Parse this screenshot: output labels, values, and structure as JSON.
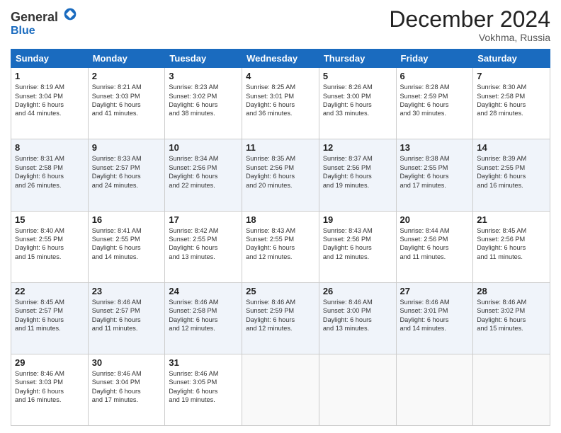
{
  "logo": {
    "general": "General",
    "blue": "Blue"
  },
  "header": {
    "month": "December 2024",
    "location": "Vokhma, Russia"
  },
  "days_of_week": [
    "Sunday",
    "Monday",
    "Tuesday",
    "Wednesday",
    "Thursday",
    "Friday",
    "Saturday"
  ],
  "weeks": [
    [
      {
        "day": "1",
        "sunrise": "8:19 AM",
        "sunset": "3:04 PM",
        "daylight": "6 hours and 44 minutes."
      },
      {
        "day": "2",
        "sunrise": "8:21 AM",
        "sunset": "3:03 PM",
        "daylight": "6 hours and 41 minutes."
      },
      {
        "day": "3",
        "sunrise": "8:23 AM",
        "sunset": "3:02 PM",
        "daylight": "6 hours and 38 minutes."
      },
      {
        "day": "4",
        "sunrise": "8:25 AM",
        "sunset": "3:01 PM",
        "daylight": "6 hours and 36 minutes."
      },
      {
        "day": "5",
        "sunrise": "8:26 AM",
        "sunset": "3:00 PM",
        "daylight": "6 hours and 33 minutes."
      },
      {
        "day": "6",
        "sunrise": "8:28 AM",
        "sunset": "2:59 PM",
        "daylight": "6 hours and 30 minutes."
      },
      {
        "day": "7",
        "sunrise": "8:30 AM",
        "sunset": "2:58 PM",
        "daylight": "6 hours and 28 minutes."
      }
    ],
    [
      {
        "day": "8",
        "sunrise": "8:31 AM",
        "sunset": "2:58 PM",
        "daylight": "6 hours and 26 minutes."
      },
      {
        "day": "9",
        "sunrise": "8:33 AM",
        "sunset": "2:57 PM",
        "daylight": "6 hours and 24 minutes."
      },
      {
        "day": "10",
        "sunrise": "8:34 AM",
        "sunset": "2:56 PM",
        "daylight": "6 hours and 22 minutes."
      },
      {
        "day": "11",
        "sunrise": "8:35 AM",
        "sunset": "2:56 PM",
        "daylight": "6 hours and 20 minutes."
      },
      {
        "day": "12",
        "sunrise": "8:37 AM",
        "sunset": "2:56 PM",
        "daylight": "6 hours and 19 minutes."
      },
      {
        "day": "13",
        "sunrise": "8:38 AM",
        "sunset": "2:55 PM",
        "daylight": "6 hours and 17 minutes."
      },
      {
        "day": "14",
        "sunrise": "8:39 AM",
        "sunset": "2:55 PM",
        "daylight": "6 hours and 16 minutes."
      }
    ],
    [
      {
        "day": "15",
        "sunrise": "8:40 AM",
        "sunset": "2:55 PM",
        "daylight": "6 hours and 15 minutes."
      },
      {
        "day": "16",
        "sunrise": "8:41 AM",
        "sunset": "2:55 PM",
        "daylight": "6 hours and 14 minutes."
      },
      {
        "day": "17",
        "sunrise": "8:42 AM",
        "sunset": "2:55 PM",
        "daylight": "6 hours and 13 minutes."
      },
      {
        "day": "18",
        "sunrise": "8:43 AM",
        "sunset": "2:55 PM",
        "daylight": "6 hours and 12 minutes."
      },
      {
        "day": "19",
        "sunrise": "8:43 AM",
        "sunset": "2:56 PM",
        "daylight": "6 hours and 12 minutes."
      },
      {
        "day": "20",
        "sunrise": "8:44 AM",
        "sunset": "2:56 PM",
        "daylight": "6 hours and 11 minutes."
      },
      {
        "day": "21",
        "sunrise": "8:45 AM",
        "sunset": "2:56 PM",
        "daylight": "6 hours and 11 minutes."
      }
    ],
    [
      {
        "day": "22",
        "sunrise": "8:45 AM",
        "sunset": "2:57 PM",
        "daylight": "6 hours and 11 minutes."
      },
      {
        "day": "23",
        "sunrise": "8:46 AM",
        "sunset": "2:57 PM",
        "daylight": "6 hours and 11 minutes."
      },
      {
        "day": "24",
        "sunrise": "8:46 AM",
        "sunset": "2:58 PM",
        "daylight": "6 hours and 12 minutes."
      },
      {
        "day": "25",
        "sunrise": "8:46 AM",
        "sunset": "2:59 PM",
        "daylight": "6 hours and 12 minutes."
      },
      {
        "day": "26",
        "sunrise": "8:46 AM",
        "sunset": "3:00 PM",
        "daylight": "6 hours and 13 minutes."
      },
      {
        "day": "27",
        "sunrise": "8:46 AM",
        "sunset": "3:01 PM",
        "daylight": "6 hours and 14 minutes."
      },
      {
        "day": "28",
        "sunrise": "8:46 AM",
        "sunset": "3:02 PM",
        "daylight": "6 hours and 15 minutes."
      }
    ],
    [
      {
        "day": "29",
        "sunrise": "8:46 AM",
        "sunset": "3:03 PM",
        "daylight": "6 hours and 16 minutes."
      },
      {
        "day": "30",
        "sunrise": "8:46 AM",
        "sunset": "3:04 PM",
        "daylight": "6 hours and 17 minutes."
      },
      {
        "day": "31",
        "sunrise": "8:46 AM",
        "sunset": "3:05 PM",
        "daylight": "6 hours and 19 minutes."
      },
      null,
      null,
      null,
      null
    ]
  ],
  "labels": {
    "sunrise": "Sunrise:",
    "sunset": "Sunset:",
    "daylight": "Daylight:"
  }
}
